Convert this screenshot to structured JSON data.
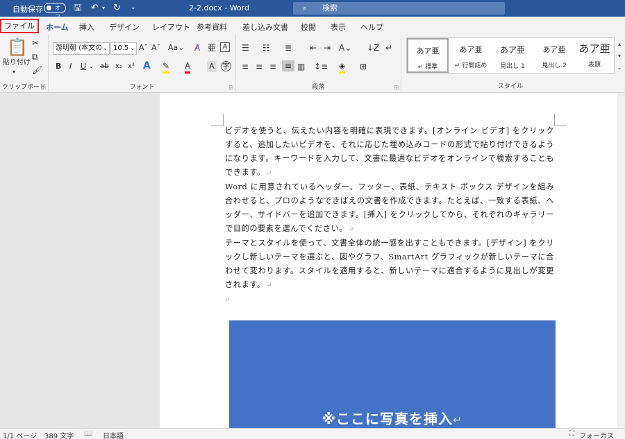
{
  "titlebar": {
    "autosave_label": "自動保存",
    "autosave_state": "オフ",
    "doc_name": "2-2.docx  -  Word",
    "search_placeholder": "検索",
    "quick_access": [
      "save-icon",
      "undo-icon",
      "redo-icon",
      "customize-icon"
    ]
  },
  "tabs": [
    "ファイル",
    "ホーム",
    "挿入",
    "デザイン",
    "レイアウト",
    "参考資料",
    "差し込み文書",
    "校閲",
    "表示",
    "ヘルプ"
  ],
  "active_tab": "ホーム",
  "ribbon": {
    "clipboard": {
      "label": "クリップボード",
      "paste_label": "貼り付け"
    },
    "font": {
      "label": "フォント",
      "font_name": "游明朝 (本文の",
      "font_size": "10.5"
    },
    "paragraph": {
      "label": "段落"
    },
    "styles": {
      "label": "スタイル",
      "items": [
        {
          "preview": "あア亜",
          "name": "↵ 標準"
        },
        {
          "preview": "あア亜",
          "name": "↵ 行間詰め"
        },
        {
          "preview": "あア亜",
          "name": "見出し 1"
        },
        {
          "preview": "あア亜",
          "name": "見出し 2"
        },
        {
          "preview": "あア亜",
          "name": "表題"
        }
      ]
    }
  },
  "document": {
    "paragraphs": [
      "ビデオを使うと、伝えたい内容を明確に表現できます。[オンライン ビデオ] をクリックすると、追加したいビデオを、それに応じた埋め込みコードの形式で貼り付けできるようになります。キーワードを入力して、文書に最適なビデオをオンラインで検索することもできます。",
      "Word に用意されているヘッダー、フッター、表紙、テキスト ボックス デザインを組み合わせると、プロのようなできばえの文書を作成できます。たとえば、一致する表紙、ヘッダー、サイドバーを追加できます。[挿入] をクリックしてから、それぞれのギャラリーで目的の要素を選んでください。",
      "テーマとスタイルを使って、文書全体の統一感を出すこともできます。[デザイン] をクリックし新しいテーマを選ぶと、図やグラフ、SmartArt グラフィックが新しいテーマに合わせて変わります。スタイルを適用すると、新しいテーマに適合するように見出しが変更されます。"
    ],
    "paragraph_mark": "↵",
    "photo_placeholder": "※ここに写真を挿入",
    "photo_color": "#4472c4"
  },
  "status": {
    "page": "1/1 ページ",
    "words": "389 文字",
    "language": "日本語",
    "focus": "フォーカス"
  },
  "colors": {
    "title_bar": "#2b579a",
    "file_tab_highlight": "#e8202a",
    "ribbon_bg": "#f3f3f3"
  }
}
